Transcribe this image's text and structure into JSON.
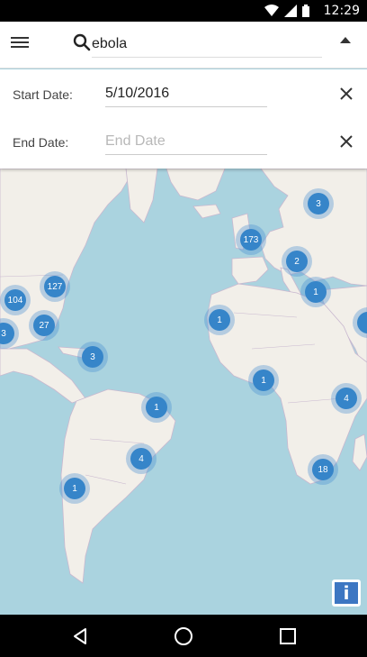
{
  "status_bar": {
    "time": "12:29"
  },
  "toolbar": {
    "search_value": "ebola",
    "menu_icon": "hamburger-menu-icon",
    "search_icon": "magnifier-icon",
    "collapse_icon": "triangle-up-icon"
  },
  "filters": {
    "start_label": "Start Date:",
    "start_value": "5/10/2016",
    "end_label": "End Date:",
    "end_placeholder": "End Date",
    "clear_icon": "close-x-icon"
  },
  "map": {
    "clusters": [
      {
        "count": "3"
      },
      {
        "count": "173"
      },
      {
        "count": "2"
      },
      {
        "count": "1"
      },
      {
        "count": "127"
      },
      {
        "count": "104"
      },
      {
        "count": "27"
      },
      {
        "count": "3"
      },
      {
        "count": "3"
      },
      {
        "count": "1"
      },
      {
        "count": "1"
      },
      {
        "count": "1"
      },
      {
        "count": "4"
      },
      {
        "count": "4"
      },
      {
        "count": "18"
      },
      {
        "count": "1"
      }
    ],
    "info_label": "i"
  },
  "colors": {
    "water": "#aad3df",
    "land": "#f2efe9",
    "cluster": "#3685c9",
    "info": "#3c76c2"
  }
}
